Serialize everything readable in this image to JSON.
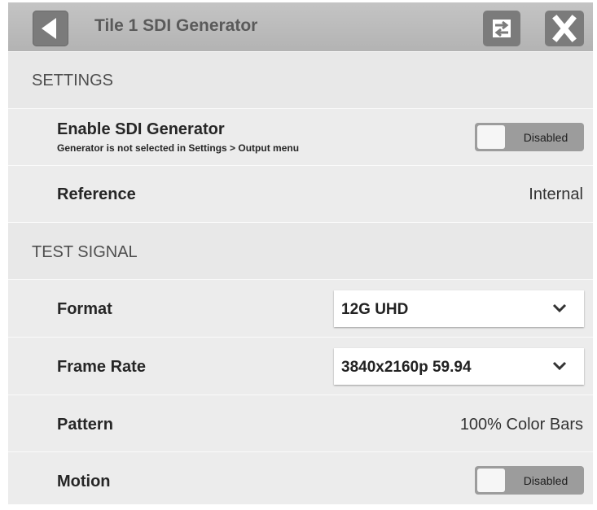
{
  "titlebar": {
    "title": "Tile 1 SDI Generator",
    "back_icon": "back-arrow-icon",
    "swap_icon": "swap-arrows-icon",
    "close_icon": "close-x-icon"
  },
  "settings": {
    "section_label": "SETTINGS",
    "enable": {
      "label": "Enable SDI Generator",
      "sublabel": "Generator is not selected in Settings > Output menu",
      "toggle_label": "Disabled"
    },
    "reference": {
      "label": "Reference",
      "value": "Internal"
    }
  },
  "test_signal": {
    "section_label": "TEST SIGNAL",
    "format": {
      "label": "Format",
      "value": "12G UHD"
    },
    "frame_rate": {
      "label": "Frame Rate",
      "value": "3840x2160p 59.94"
    },
    "pattern": {
      "label": "Pattern",
      "value": "100% Color Bars"
    },
    "motion": {
      "label": "Motion",
      "toggle_label": "Disabled"
    }
  },
  "colors": {
    "titlebar": "#bcbcbc",
    "icon_button": "#7b7b7b",
    "panel": "#ececec",
    "toggle_off": "#9c9c9c"
  }
}
